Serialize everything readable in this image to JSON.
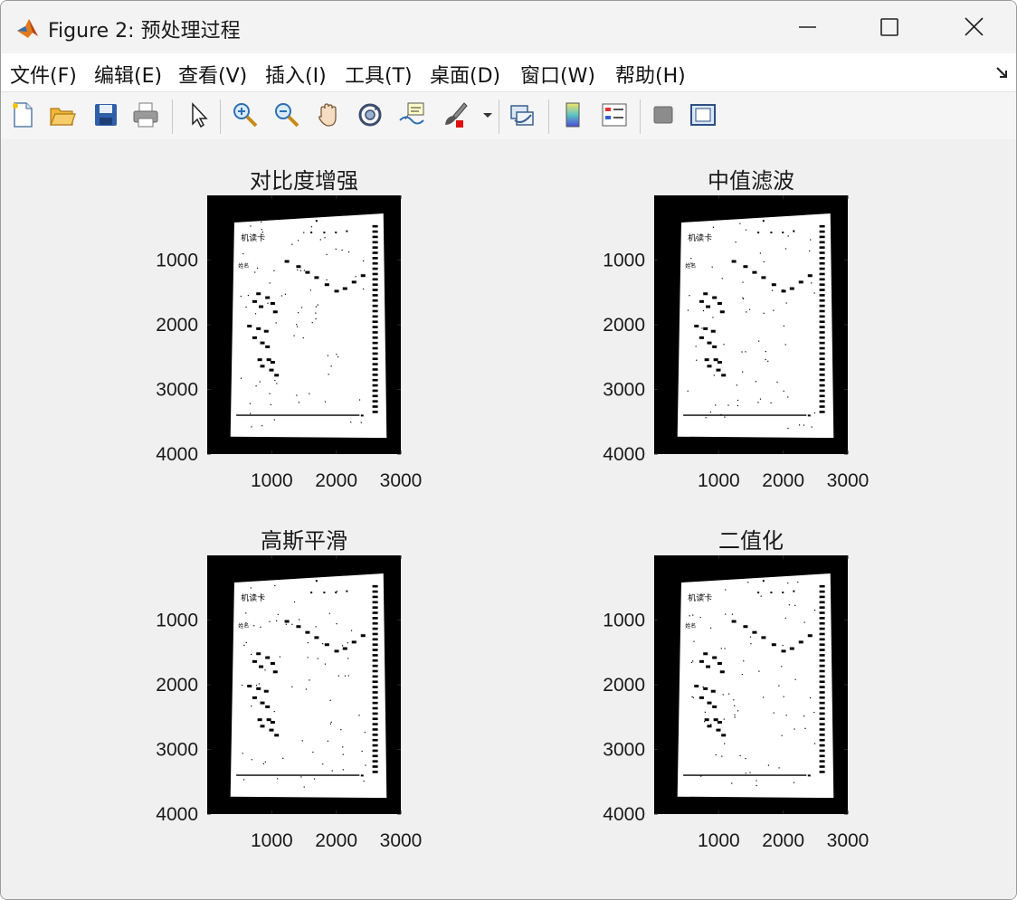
{
  "window": {
    "title": "Figure 2: 预处理过程",
    "app_icon": "matlab-icon",
    "controls": [
      "minimize-icon",
      "maximize-icon",
      "close-icon"
    ]
  },
  "menu": {
    "items": [
      "文件(F)",
      "编辑(E)",
      "查看(V)",
      "插入(I)",
      "工具(T)",
      "桌面(D)",
      "窗口(W)",
      "帮助(H)"
    ],
    "dock_icon": "dock-arrow-icon"
  },
  "toolbar": {
    "tools": [
      "new-figure-icon",
      "open-file-icon",
      "save-icon",
      "print-icon",
      "edit-plot-arrow-icon",
      "zoom-in-icon",
      "zoom-out-icon",
      "pan-hand-icon",
      "rotate-3d-icon",
      "data-cursor-icon",
      "brush-icon",
      "brush-dropdown-icon",
      "link-plot-icon",
      "insert-colorbar-icon",
      "insert-legend-icon",
      "hide-plot-tools-icon",
      "show-plot-tools-icon"
    ]
  },
  "colors": {
    "paper": "#ffffff",
    "background": "#000000",
    "canvas": "#f0f0f0"
  },
  "axes": [
    {
      "title": "对比度增强",
      "xticks": [
        "1000",
        "2000",
        "3000"
      ],
      "yticks": [
        "1000",
        "2000",
        "3000",
        "4000"
      ]
    },
    {
      "title": "中值滤波",
      "xticks": [
        "1000",
        "2000",
        "3000"
      ],
      "yticks": [
        "1000",
        "2000",
        "3000",
        "4000"
      ]
    },
    {
      "title": "高斯平滑",
      "xticks": [
        "1000",
        "2000",
        "3000"
      ],
      "yticks": [
        "1000",
        "2000",
        "3000",
        "4000"
      ]
    },
    {
      "title": "二值化",
      "xticks": [
        "1000",
        "2000",
        "3000"
      ],
      "yticks": [
        "1000",
        "2000",
        "3000",
        "4000"
      ]
    }
  ],
  "card_text": {
    "header": "机读卡",
    "sub": "姓名"
  }
}
